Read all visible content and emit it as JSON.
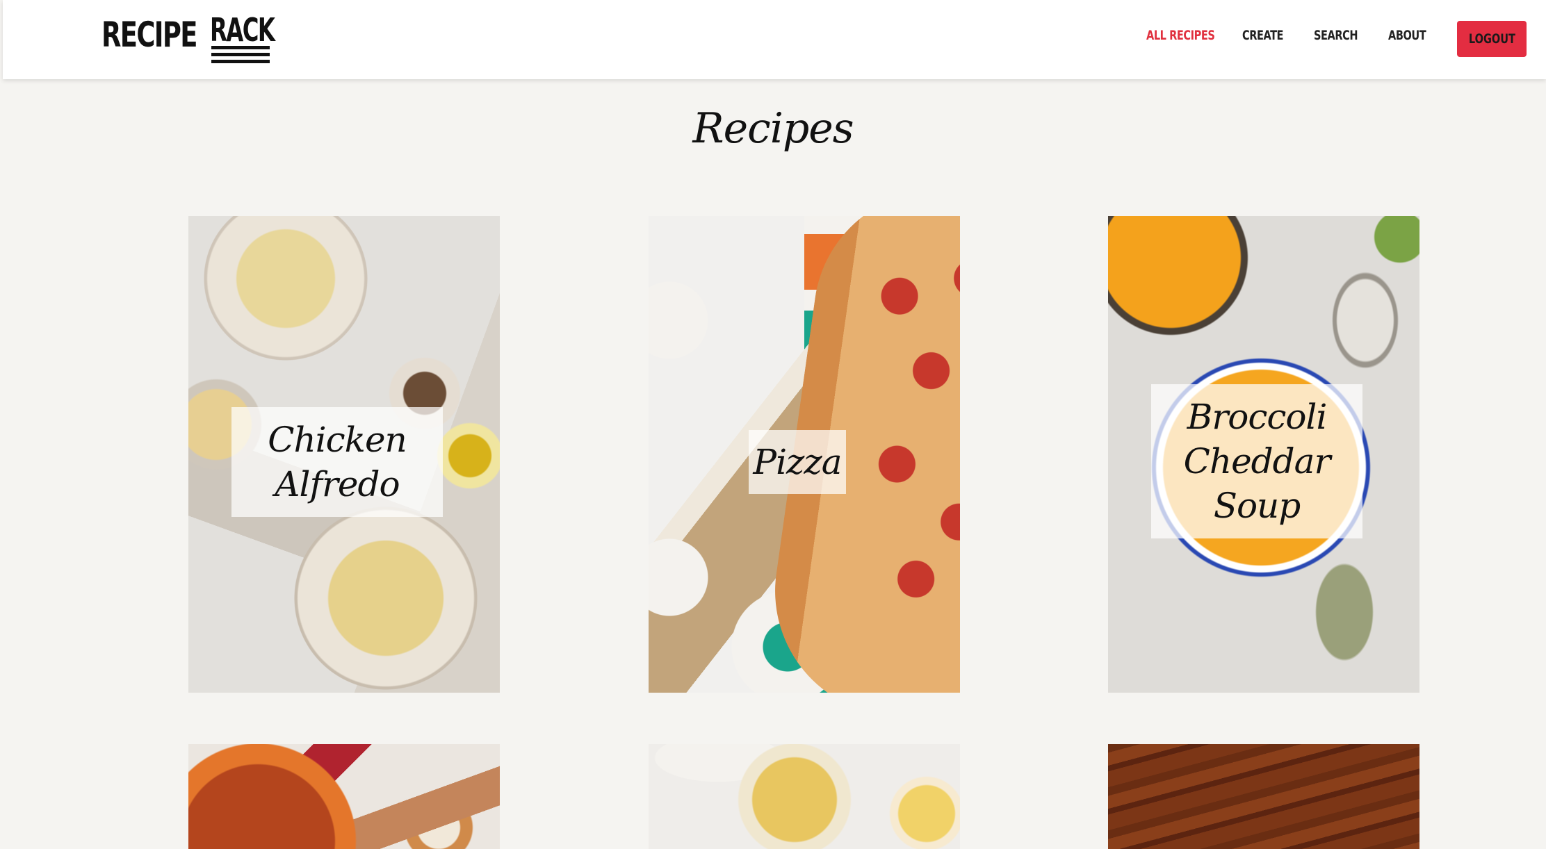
{
  "brand": {
    "name_part1": "RECIPE",
    "name_part2": "RACK"
  },
  "nav": {
    "links": [
      {
        "label": "ALL RECIPES",
        "active": true
      },
      {
        "label": "CREATE",
        "active": false
      },
      {
        "label": "SEARCH",
        "active": false
      },
      {
        "label": "ABOUT",
        "active": false
      }
    ],
    "logout_label": "LOGOUT"
  },
  "page": {
    "title": "Recipes"
  },
  "recipes": [
    {
      "name": "Chicken Alfredo",
      "image": "pasta-photo"
    },
    {
      "name": "Pizza",
      "image": "pizza-photo"
    },
    {
      "name": "Broccoli Cheddar Soup",
      "image": "soup-photo"
    },
    {
      "name": "",
      "image": "stew-photo"
    },
    {
      "name": "",
      "image": "tea-photo"
    },
    {
      "name": "",
      "image": "wood-photo"
    }
  ],
  "colors": {
    "accent": "#e32d41",
    "background": "#f5f4f1",
    "navbar": "#ffffff"
  }
}
